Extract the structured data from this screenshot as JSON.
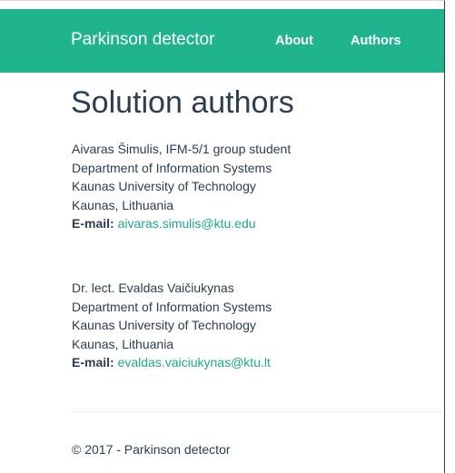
{
  "navbar": {
    "brand": "Parkinson detector",
    "links": [
      "About",
      "Authors"
    ],
    "color": "#20b48e"
  },
  "page": {
    "title": "Solution authors"
  },
  "authors": [
    {
      "name_line": "Aivaras Šimulis, IFM-5/1 group student",
      "department": "Department of Information Systems",
      "university": "Kaunas University of Technology",
      "location": "Kaunas, Lithuania",
      "email_label": "E-mail:",
      "email": "aivaras.simulis@ktu.edu"
    },
    {
      "name_line": "Dr. lect. Evaldas Vaičiukynas",
      "department": "Department of Information Systems",
      "university": "Kaunas University of Technology",
      "location": "Kaunas, Lithuania",
      "email_label": "E-mail:",
      "email": "evaldas.vaiciukynas@ktu.lt"
    }
  ],
  "footer": {
    "text": "© 2017 - Parkinson detector"
  },
  "colors": {
    "link": "#21a886",
    "text": "#2c3e50"
  }
}
